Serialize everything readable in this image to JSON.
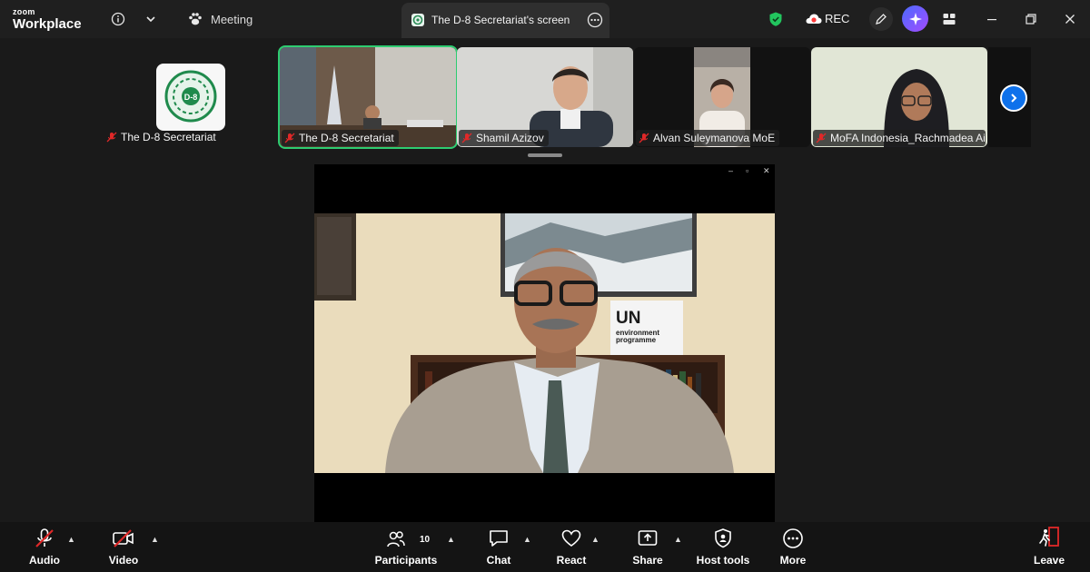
{
  "app": {
    "brand_small": "zoom",
    "brand_big": "Workplace"
  },
  "topbar": {
    "meeting_label": "Meeting",
    "share_tab_title": "The D-8 Secretariat's screen",
    "rec_label": "REC"
  },
  "participants_strip": [
    {
      "name": "The D-8 Secretariat",
      "muted": true,
      "video": false
    },
    {
      "name": "The D-8 Secretariat",
      "muted": true,
      "video": true,
      "active_speaker": true
    },
    {
      "name": "Shamil Azizov",
      "muted": true,
      "video": true
    },
    {
      "name": "Alvan Suleymanova MoE",
      "muted": true,
      "video": true
    },
    {
      "name": "MoFA Indonesia_Rachmadea Ai...",
      "muted": true,
      "video": true
    }
  ],
  "shared_screen": {
    "sign_line1": "UN",
    "sign_line2": "environment",
    "sign_line3": "programme"
  },
  "toolbar": {
    "audio_label": "Audio",
    "video_label": "Video",
    "participants_label": "Participants",
    "participants_count": "10",
    "chat_label": "Chat",
    "react_label": "React",
    "share_label": "Share",
    "hosttools_label": "Host tools",
    "more_label": "More",
    "leave_label": "Leave"
  },
  "colors": {
    "accent": "#0e71eb",
    "active_speaker_border": "#2ecc71",
    "muted_red": "#e02828",
    "shield_green": "#22c55e",
    "rec_red": "#ff3b3b"
  }
}
